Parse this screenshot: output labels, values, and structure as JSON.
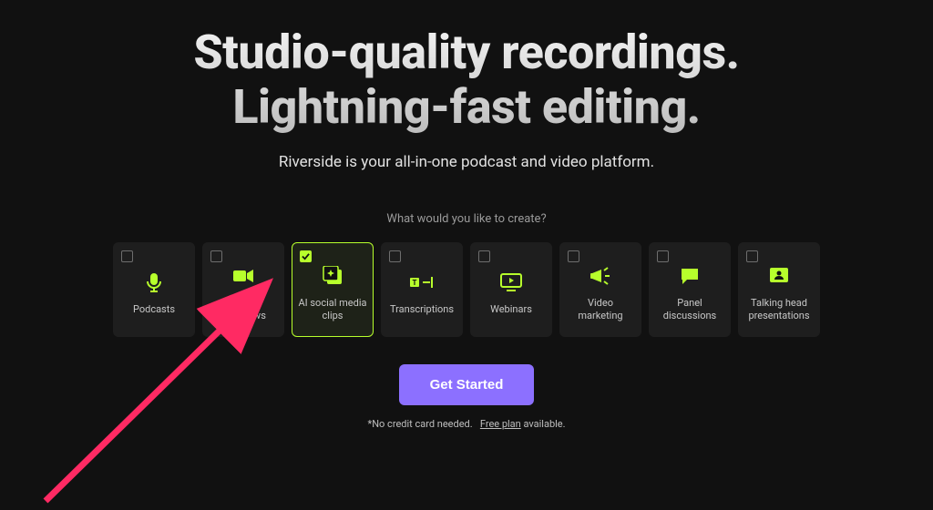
{
  "hero": {
    "title_line1": "Studio-quality recordings.",
    "title_line2": "Lightning-fast editing.",
    "subtitle": "Riverside is your all-in-one podcast and video platform."
  },
  "prompt_text": "What would you like to create?",
  "options": [
    {
      "label": "Podcasts",
      "selected": false,
      "icon": "mic-icon"
    },
    {
      "label": "Video interviews",
      "selected": false,
      "icon": "video-icon"
    },
    {
      "label": "AI social media clips",
      "selected": true,
      "icon": "sparkle-clip-icon"
    },
    {
      "label": "Transcriptions",
      "selected": false,
      "icon": "text-caret-icon"
    },
    {
      "label": "Webinars",
      "selected": false,
      "icon": "screen-icon"
    },
    {
      "label": "Video marketing",
      "selected": false,
      "icon": "megaphone-icon"
    },
    {
      "label": "Panel discussions",
      "selected": false,
      "icon": "chat-icon"
    },
    {
      "label": "Talking head presentations",
      "selected": false,
      "icon": "person-card-icon"
    }
  ],
  "cta": {
    "label": "Get Started"
  },
  "disclaimer": {
    "prefix": "*No credit card needed.",
    "link_text": "Free plan",
    "suffix": " available."
  },
  "colors": {
    "accent_green": "#b7ff2c",
    "accent_purple": "#8c70ff",
    "arrow": "#ff2a63"
  }
}
